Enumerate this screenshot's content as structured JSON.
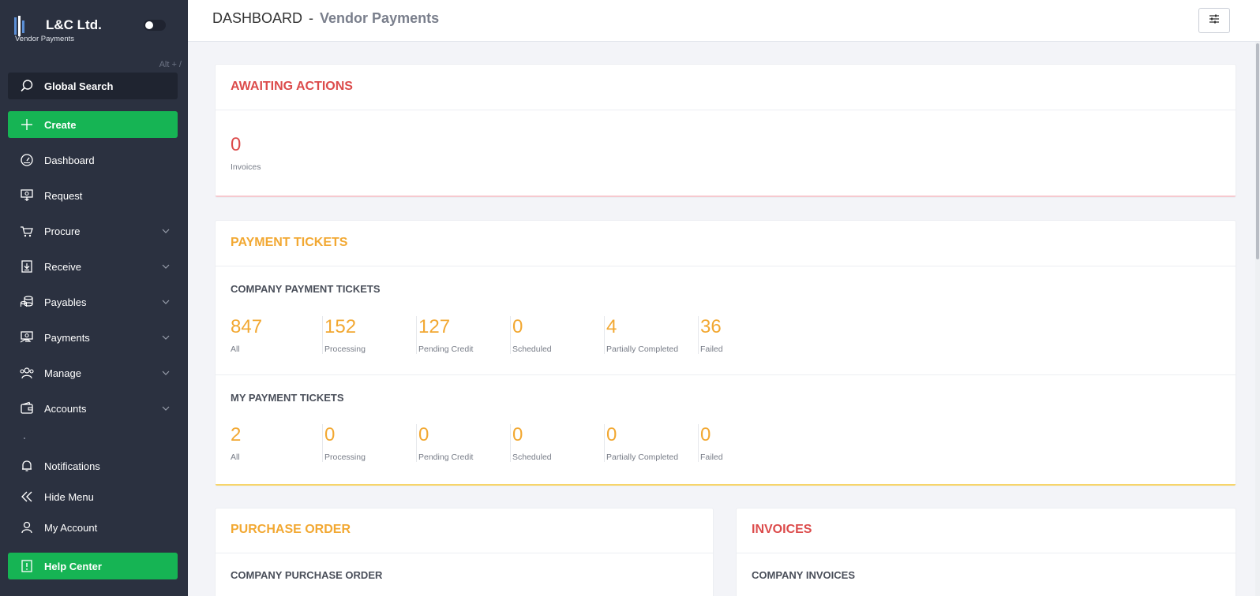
{
  "brand": {
    "name": "L&C Ltd.",
    "subtitle": "Vendor Payments"
  },
  "sidebar": {
    "search_hint": "Alt + /",
    "search_label": "Global Search",
    "create_label": "Create",
    "items": [
      {
        "label": "Dashboard",
        "icon": "speedometer-icon"
      },
      {
        "label": "Request",
        "icon": "request-icon"
      },
      {
        "label": "Procure",
        "icon": "cart-icon"
      },
      {
        "label": "Receive",
        "icon": "receive-icon"
      },
      {
        "label": "Payables",
        "icon": "coins-icon"
      },
      {
        "label": "Payments",
        "icon": "payments-icon"
      },
      {
        "label": "Manage",
        "icon": "users-icon"
      },
      {
        "label": "Accounts",
        "icon": "wallet-icon"
      }
    ],
    "notifications_label": "Notifications",
    "hide_menu_label": "Hide Menu",
    "my_account_label": "My Account",
    "help_center_label": "Help Center"
  },
  "header": {
    "title": "DASHBOARD",
    "separator": "-",
    "subtitle": "Vendor Payments"
  },
  "awaiting": {
    "title": "AWAITING ACTIONS",
    "value": "0",
    "caption": "Invoices"
  },
  "payment_tickets": {
    "title": "PAYMENT TICKETS",
    "company": {
      "title": "COMPANY PAYMENT TICKETS",
      "stats": [
        {
          "value": "847",
          "label": "All"
        },
        {
          "value": "152",
          "label": "Processing"
        },
        {
          "value": "127",
          "label": "Pending Credit"
        },
        {
          "value": "0",
          "label": "Scheduled"
        },
        {
          "value": "4",
          "label": "Partially Completed"
        },
        {
          "value": "36",
          "label": "Failed"
        }
      ]
    },
    "mine": {
      "title": "MY PAYMENT TICKETS",
      "stats": [
        {
          "value": "2",
          "label": "All"
        },
        {
          "value": "0",
          "label": "Processing"
        },
        {
          "value": "0",
          "label": "Pending Credit"
        },
        {
          "value": "0",
          "label": "Scheduled"
        },
        {
          "value": "0",
          "label": "Partially Completed"
        },
        {
          "value": "0",
          "label": "Failed"
        }
      ]
    }
  },
  "purchase_order": {
    "title": "PURCHASE ORDER",
    "subtitle": "COMPANY PURCHASE ORDER"
  },
  "invoices": {
    "title": "INVOICES",
    "subtitle": "COMPANY INVOICES"
  },
  "colors": {
    "sidebar": "#2b3140",
    "green": "#16b454",
    "red": "#dc4b4b",
    "orange": "#f2a832"
  }
}
